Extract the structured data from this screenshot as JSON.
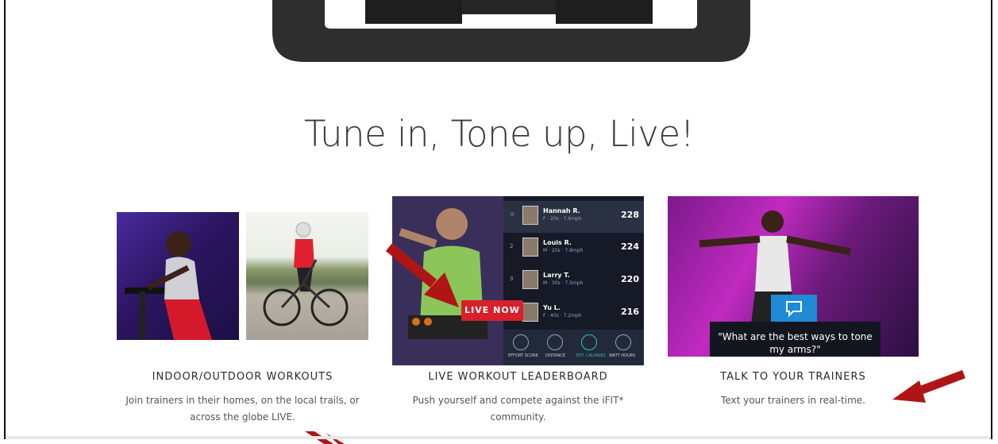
{
  "headline": "Tune in, Tone up, Live!",
  "features": [
    {
      "title": "INDOOR/OUTDOOR WORKOUTS",
      "description": "Join trainers in their homes, on the local trails, or across the globe LIVE."
    },
    {
      "title": "LIVE WORKOUT LEADERBOARD",
      "description": "Push yourself and compete against the iFIT* community."
    },
    {
      "title": "TALK TO YOUR TRAINERS",
      "description": "Text your trainers in real-time."
    }
  ],
  "leaderboard": {
    "badge": "LIVE NOW",
    "rows": [
      {
        "rank": "",
        "name": "Hannah R.",
        "meta": "F · 20s · 7.6mph",
        "score": "228"
      },
      {
        "rank": "2",
        "name": "Louis R.",
        "meta": "M · 20s · 7.8mph",
        "score": "224"
      },
      {
        "rank": "3",
        "name": "Larry T.",
        "meta": "M · 30s · 7.5mph",
        "score": "220"
      },
      {
        "rank": "",
        "name": "Yu L.",
        "meta": "F · 40s · 7.2mph",
        "score": "216"
      }
    ],
    "stats": [
      "EFFORT SCORE",
      "DISTANCE",
      "EST. CALORIES",
      "WATT HOURS"
    ]
  },
  "chat": {
    "message": "\"What are the best ways to tone my arms?\""
  },
  "colors": {
    "accent_red": "#d8202c",
    "arrow_red": "#b01515",
    "chat_blue": "#1f8ad6"
  }
}
